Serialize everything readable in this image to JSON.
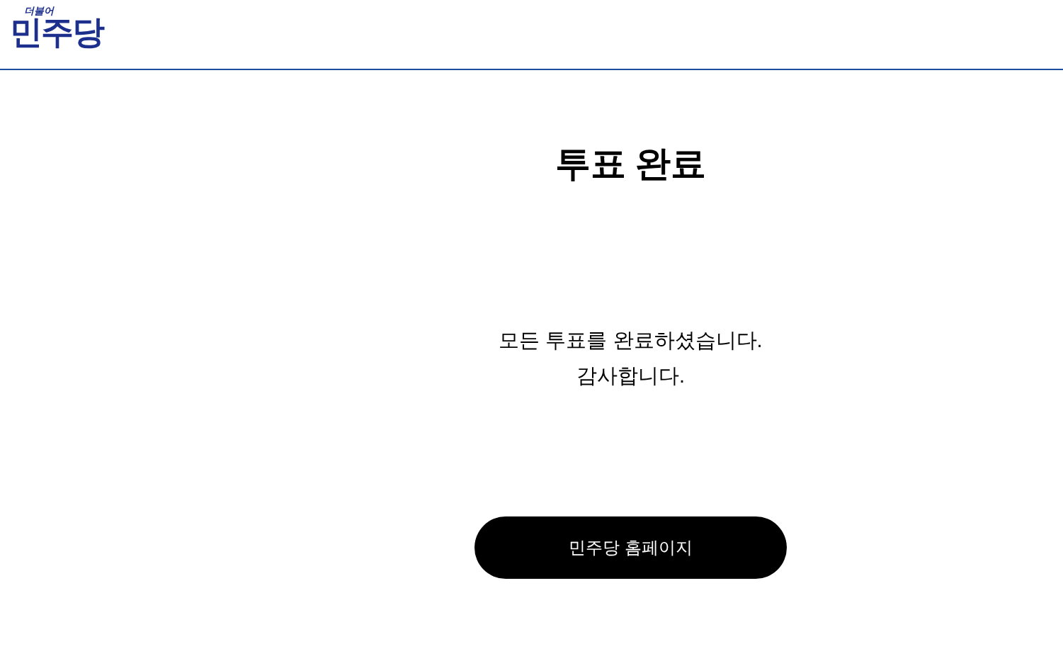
{
  "header": {
    "logo_small": "더불어",
    "logo_main": "민주당"
  },
  "title": "투표 완료",
  "message": [
    "모든 투표를 완료하셨습니다.",
    "감사합니다."
  ],
  "button": "민주당 홈페이지"
}
